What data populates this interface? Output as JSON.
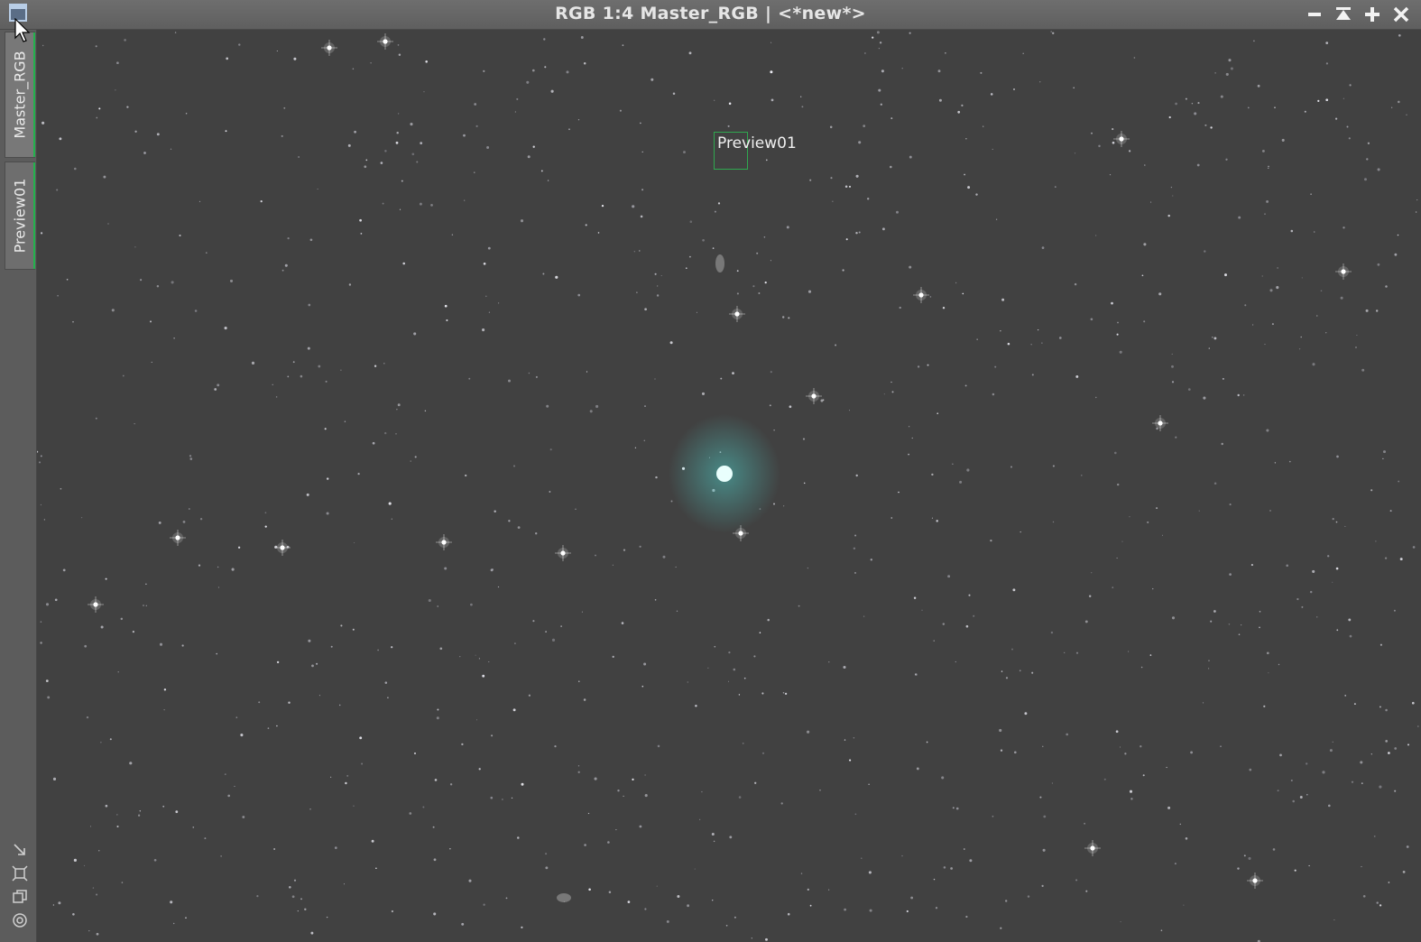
{
  "window": {
    "title": "RGB 1:4 Master_RGB | <*new*>",
    "controls": [
      "minimize-icon",
      "shade-icon",
      "maximize-icon",
      "close-icon"
    ]
  },
  "sidebar": {
    "tabs": [
      {
        "label": "Master_RGB",
        "active": true
      },
      {
        "label": "Preview01",
        "active": false
      }
    ],
    "tools": [
      "resize-icon",
      "fit-view-icon",
      "clone-icon",
      "target-icon"
    ]
  },
  "image": {
    "preview_label": "Preview01",
    "background_color": "#414141",
    "preview_color": "#2fa84f",
    "nebula_color": "#4fc6c0"
  }
}
